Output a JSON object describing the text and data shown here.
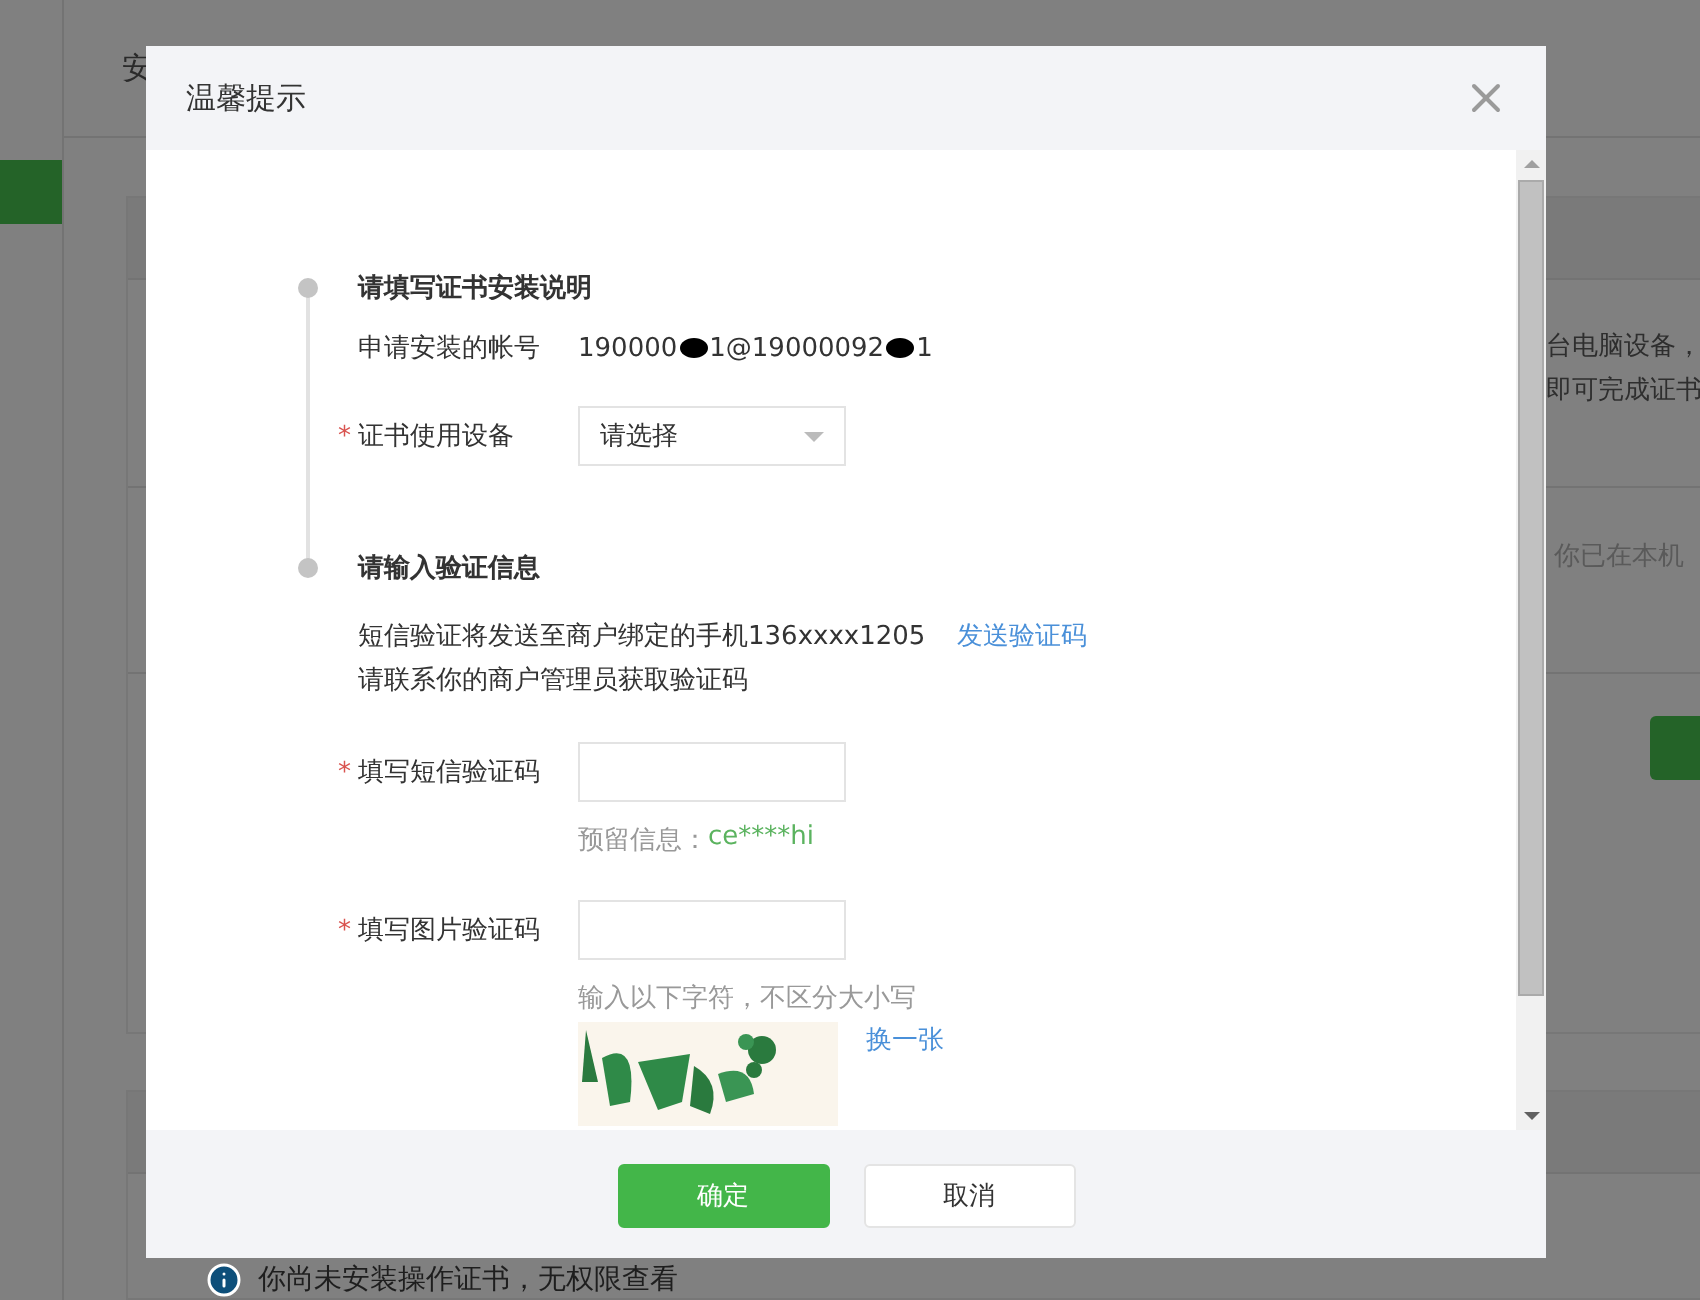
{
  "background": {
    "page_title": "安",
    "side_texts": [
      "台电脑设备，",
      "即可完成证书"
    ],
    "status_text": "你已在本机",
    "notice": "你尚未安装操作证书，无权限查看"
  },
  "dialog": {
    "title": "温馨提示",
    "steps": [
      {
        "title": "请填写证书安装说明"
      },
      {
        "title": "请输入验证信息"
      }
    ],
    "account": {
      "label": "申请安装的帐号",
      "value_parts": [
        "190000",
        "1@19000092",
        "1"
      ]
    },
    "device": {
      "required_mark": "*",
      "label": "证书使用设备",
      "placeholder": "请选择"
    },
    "sms": {
      "notice_lines": [
        "短信验证将发送至商户绑定的手机136xxxx1205",
        "请联系你的商户管理员获取验证码"
      ],
      "send_link": "发送验证码"
    },
    "sms_code": {
      "required_mark": "*",
      "label": "填写短信验证码",
      "hint_label": "预留信息：",
      "hint_value": "ce****hi"
    },
    "image_code": {
      "required_mark": "*",
      "label": "填写图片验证码",
      "hint": "输入以下字符，不区分大小写",
      "refresh_link": "换一张"
    },
    "buttons": [
      {
        "label": "确定",
        "kind": "primary"
      },
      {
        "label": "取消",
        "kind": "secondary"
      }
    ]
  }
}
